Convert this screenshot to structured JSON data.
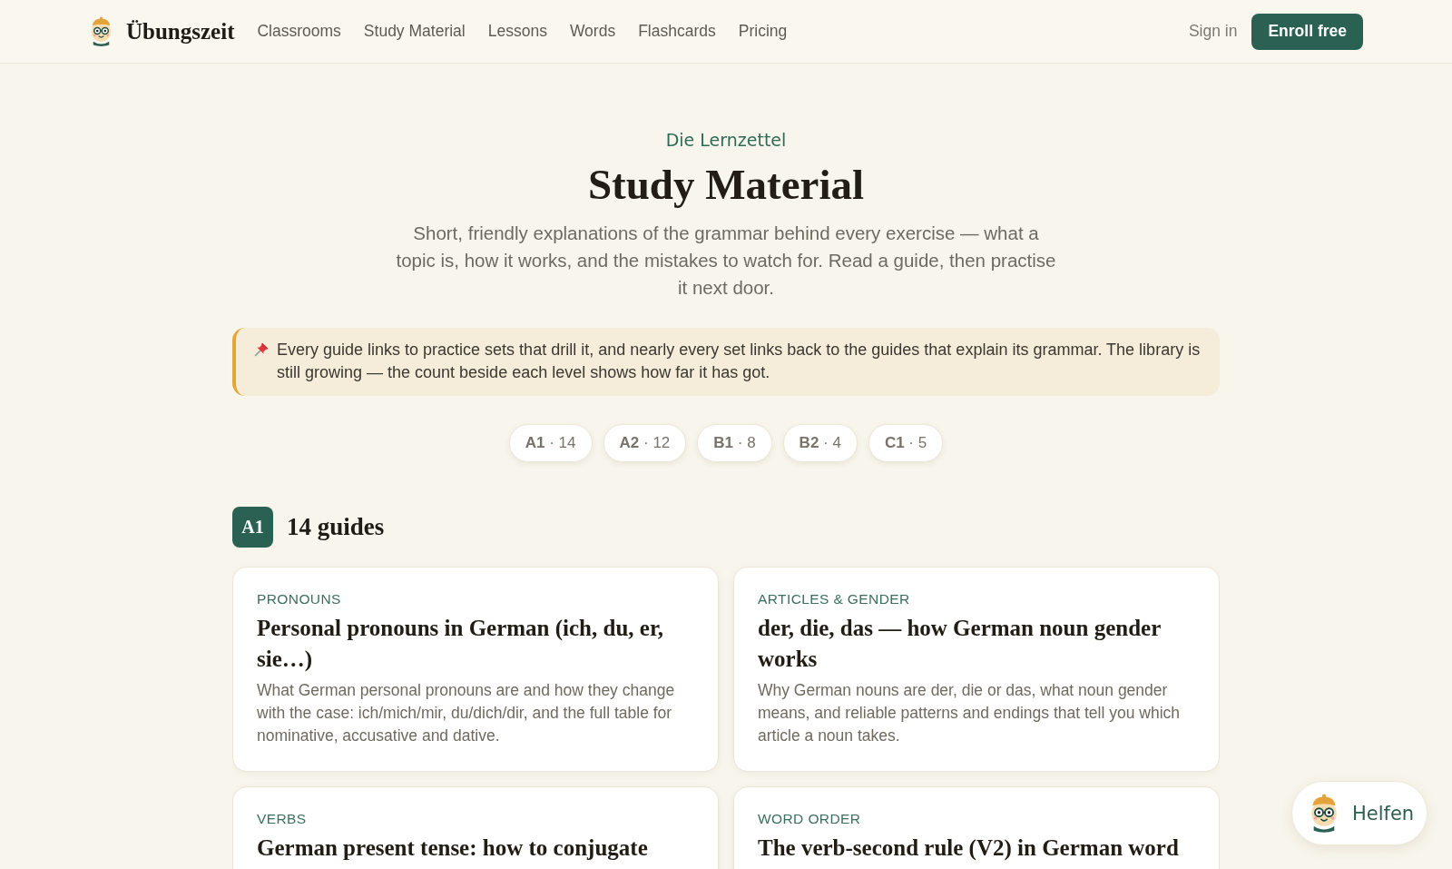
{
  "header": {
    "brand": "Übungszeit",
    "nav": [
      {
        "label": "Classrooms"
      },
      {
        "label": "Study Material"
      },
      {
        "label": "Lessons"
      },
      {
        "label": "Words"
      },
      {
        "label": "Flashcards"
      },
      {
        "label": "Pricing"
      }
    ],
    "sign_in": "Sign in",
    "enroll_button": "Enroll free"
  },
  "hero": {
    "eyebrow": "Die Lernzettel",
    "title": "Study Material",
    "intro": "Short, friendly explanations of the grammar behind every exercise — what a topic is, how it works, and the mistakes to watch for. Read a guide, then practise it next door."
  },
  "note": {
    "text": "Every guide links to practice sets that drill it, and nearly every set links back to the guides that explain its grammar. The library is still growing — the count beside each level shows how far it has got."
  },
  "level_filters": [
    {
      "label": "**A1** · 14"
    },
    {
      "label": "**A2** · 12"
    },
    {
      "label": "**B1** · 8"
    },
    {
      "label": "**B2** · 4"
    },
    {
      "label": "**C1** · 5"
    }
  ],
  "section": {
    "badge": "A1",
    "heading": "14 guides",
    "cards": [
      {
        "category": "PRONOUNS",
        "title": "Personal pronouns in German (ich, du, er, sie…)",
        "description": "What German personal pronouns are and how they change with the case: ich/mich/mir, du/dich/dir, and the full table for nominative, accusative and dative."
      },
      {
        "category": "ARTICLES & GENDER",
        "title": "der, die, das — how German noun gender works",
        "description": "Why German nouns are der, die or das, what noun gender means, and reliable patterns and endings that tell you which article a noun takes."
      },
      {
        "category": "VERBS",
        "title": "German present tense: how to conjugate"
      },
      {
        "category": "WORD ORDER",
        "title": "The verb-second rule (V2) in German word"
      }
    ]
  },
  "help_button": {
    "label": "Helfen"
  }
}
